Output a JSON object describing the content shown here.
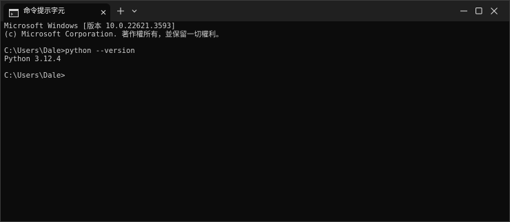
{
  "tab": {
    "title": "命令提示字元",
    "icon": "terminal-icon"
  },
  "titlebar": {
    "new_tab_icon": "plus-icon",
    "dropdown_icon": "chevron-down-icon",
    "minimize_icon": "minimize-icon",
    "maximize_icon": "maximize-icon",
    "close_icon": "close-icon"
  },
  "terminal": {
    "lines": [
      "Microsoft Windows [版本 10.0.22621.3593]",
      "(c) Microsoft Corporation. 著作權所有，並保留一切權利。",
      "",
      "C:\\Users\\Dale>python --version",
      "Python 3.12.4",
      "",
      "C:\\Users\\Dale>"
    ]
  },
  "colors": {
    "background": "#0c0c0c",
    "titlebar": "#202020",
    "text": "#cccccc"
  }
}
